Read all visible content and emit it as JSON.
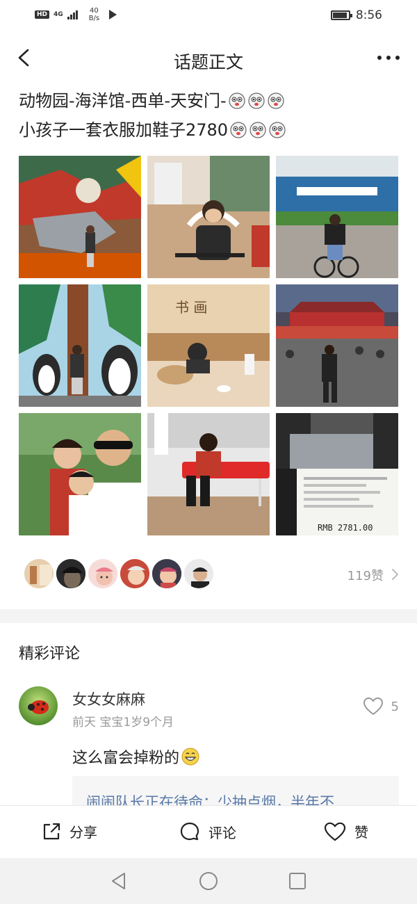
{
  "status_bar": {
    "hd": "HD",
    "network": "4G",
    "speed_value": "40",
    "speed_unit": "B/s",
    "time": "8:56",
    "battery_level": 0.9
  },
  "nav": {
    "title": "话题正文",
    "back_icon": "chevron-left-icon",
    "more_icon": "more-dots-icon"
  },
  "post": {
    "line1": "动物园-海洋馆-西单-天安门-",
    "line2": "小孩子一套衣服加鞋子2780",
    "photos": [
      {
        "name": "photo-mural-dinosaur"
      },
      {
        "name": "photo-boy-bike-indoor"
      },
      {
        "name": "photo-aquarium-entrance"
      },
      {
        "name": "photo-penguin-mural"
      },
      {
        "name": "photo-restaurant-table"
      },
      {
        "name": "photo-tiananmen-night"
      },
      {
        "name": "photo-family-selfie"
      },
      {
        "name": "photo-boy-red-bench"
      },
      {
        "name": "photo-receipt"
      }
    ],
    "receipt_amount": "RMB 2781.00"
  },
  "likes": {
    "count_label": "119赞",
    "avatars": [
      "avatar-1",
      "avatar-2",
      "avatar-3",
      "avatar-4",
      "avatar-5",
      "avatar-6"
    ]
  },
  "comments": {
    "section_title": "精彩评论",
    "items": [
      {
        "author": "女女女麻麻",
        "meta": "前天 宝宝1岁9个月",
        "likes": "5",
        "body": "这么富会掉粉的",
        "reply": {
          "name": "闹闹队长",
          "text": "正在待命：少抽点烟，半年不"
        }
      }
    ]
  },
  "actions": {
    "share": "分享",
    "comment": "评论",
    "like": "赞"
  },
  "colors": {
    "accent_link": "#5878a8",
    "muted": "#999999",
    "text": "#222222"
  }
}
